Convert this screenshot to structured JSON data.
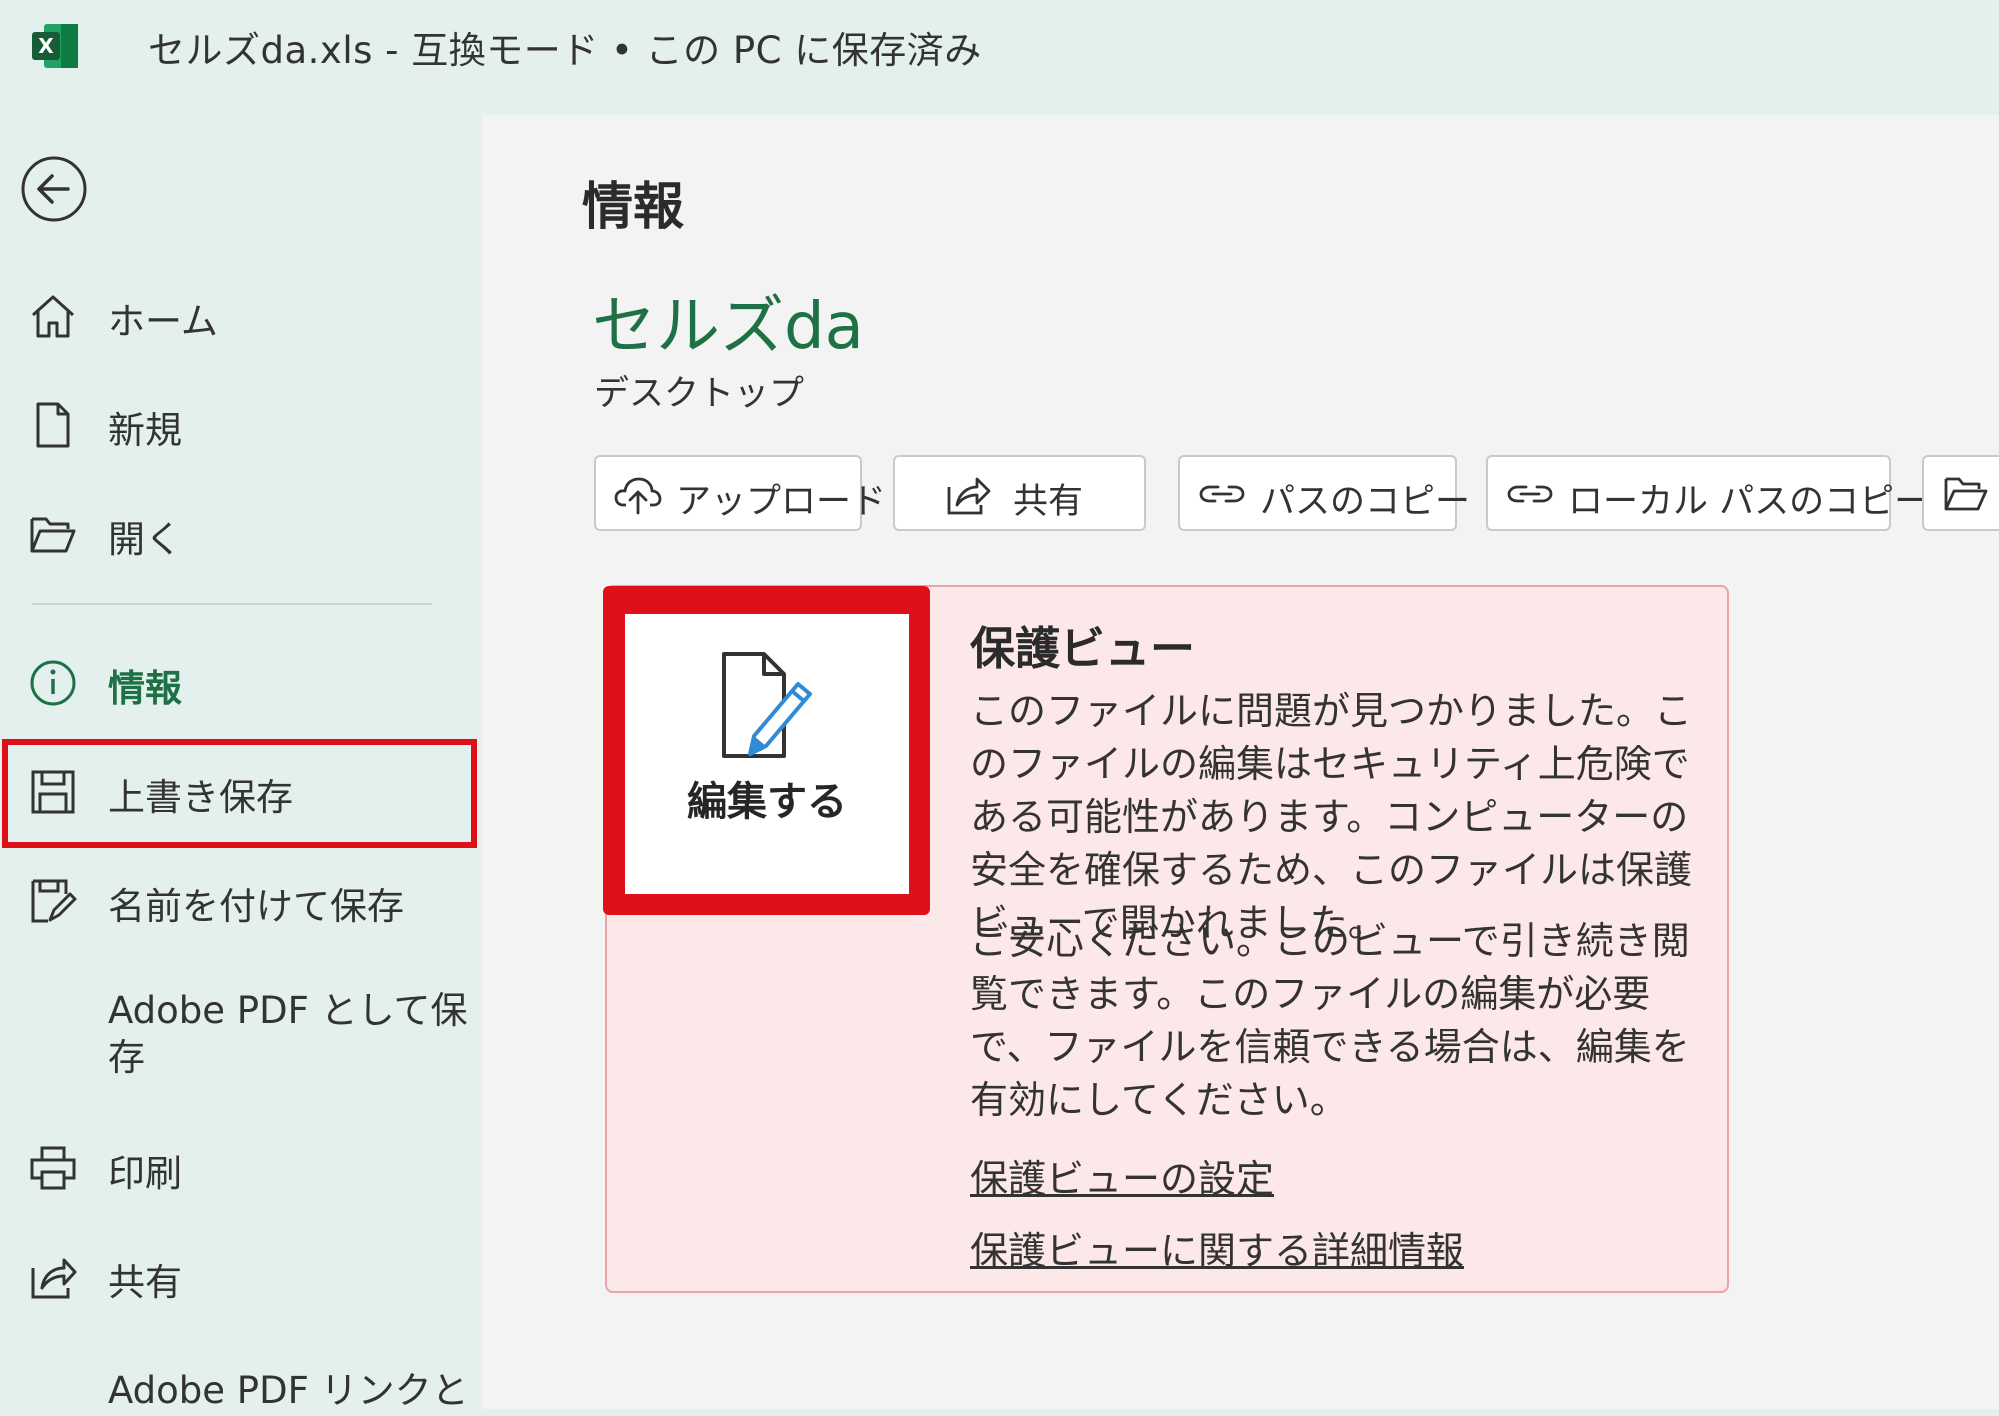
{
  "window": {
    "title": "セルズda.xls  -  互換モード • この PC に保存済み",
    "app_icon": "excel-icon",
    "app_icon_letter": "X"
  },
  "sidebar": {
    "back_icon": "back-arrow-icon",
    "items": [
      {
        "label": "ホーム",
        "icon": "home-icon"
      },
      {
        "label": "新規",
        "icon": "new-document-icon"
      },
      {
        "label": "開く",
        "icon": "open-folder-icon"
      },
      {
        "label": "情報",
        "icon": "info-icon",
        "active": true
      },
      {
        "label": "上書き保存",
        "icon": "save-icon"
      },
      {
        "label": "名前を付けて保存",
        "icon": "save-as-icon"
      },
      {
        "label": "Adobe PDF として保存",
        "icon": ""
      },
      {
        "label": "印刷",
        "icon": "print-icon"
      },
      {
        "label": "共有",
        "icon": "share-icon"
      },
      {
        "label": "Adobe PDF リンクと",
        "icon": ""
      }
    ]
  },
  "main": {
    "page_title": "情報",
    "doc_name": "セルズda",
    "doc_location": "デスクトップ",
    "toolbar": [
      {
        "label": "アップロード",
        "icon": "cloud-upload-icon"
      },
      {
        "label": "共有",
        "icon": "share-icon"
      },
      {
        "label": "パスのコピー",
        "icon": "link-icon"
      },
      {
        "label": "ローカル パスのコピー",
        "icon": "link-icon"
      },
      {
        "label": "",
        "icon": "open-folder-icon"
      }
    ],
    "protected_view": {
      "edit_button_label": "編集する",
      "title": "保護ビュー",
      "paragraph1": "このファイルに問題が見つかりました。このファイルの編集はセキュリティ上危険である可能性があります。コンピューターの安全を確保するため、このファイルは保護ビューで開かれました。",
      "paragraph2": "ご安心ください。このビューで引き続き閲覧できます。このファイルの編集が必要で、ファイルを信頼できる場合は、編集を有効にしてください。",
      "link1": "保護ビューの設定",
      "link2": "保護ビューに関する詳細情報"
    }
  },
  "colors": {
    "accent_green": "#1e7145",
    "highlight_red": "#e0101a",
    "warning_bg": "#fde8e9"
  }
}
